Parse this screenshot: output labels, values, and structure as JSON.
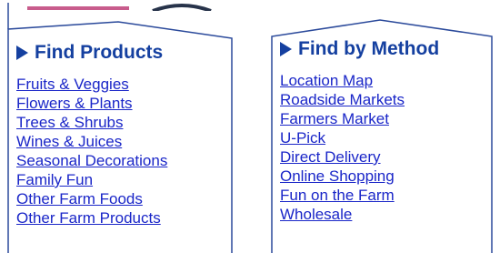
{
  "colors": {
    "panel_border": "#2b4a9b",
    "title_text": "#1540a0",
    "link_text": "#1a26c8",
    "banner_pink": "#c85c8c",
    "banner_dark": "#27334a"
  },
  "find_products": {
    "icon": "play-triangle-icon",
    "title": "Find Products",
    "links": [
      "Fruits & Veggies",
      "Flowers & Plants",
      "Trees & Shrubs",
      "Wines & Juices",
      "Seasonal Decorations",
      "Family Fun",
      "Other Farm Foods",
      "Other Farm Products"
    ]
  },
  "find_by_method": {
    "icon": "play-triangle-icon",
    "title": "Find by Method",
    "links": [
      "Location Map",
      "Roadside Markets",
      "Farmers Market",
      "U-Pick",
      "Direct Delivery",
      "Online Shopping",
      "Fun on the Farm",
      "Wholesale"
    ]
  }
}
